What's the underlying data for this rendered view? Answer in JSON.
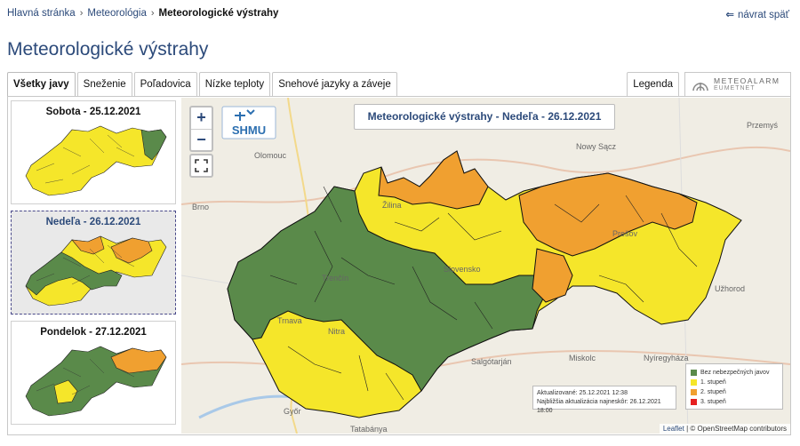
{
  "breadcrumb": {
    "home": "Hlavná stránka",
    "section": "Meteorológia",
    "current": "Meteorologické výstrahy"
  },
  "back_link": "návrat späť",
  "page_title": "Meteorologické výstrahy",
  "tabs": [
    "Všetky javy",
    "Sneženie",
    "Poľadovica",
    "Nízke teploty",
    "Snehové jazyky a záveje"
  ],
  "active_tab": "Všetky javy",
  "legend_tab": "Legenda",
  "meteoalarm": {
    "line1": "METEOALARM",
    "line2": "EUMETNET"
  },
  "days": [
    {
      "label": "Sobota - 25.12.2021",
      "selected": false
    },
    {
      "label": "Nedeľa - 26.12.2021",
      "selected": true
    },
    {
      "label": "Pondelok - 27.12.2021",
      "selected": false
    }
  ],
  "map": {
    "title": "Meteorologické výstrahy - Nedeľa - 26.12.2021",
    "zoom_in": "+",
    "zoom_out": "−",
    "logo_text": "SHMU",
    "cities": [
      "Olomouc",
      "Nowy Sącz",
      "Przemyś",
      "Brno",
      "Žilina",
      "Trenčín",
      "Prešov",
      "Slovensko",
      "Trnava",
      "Nitra",
      "Miskolc",
      "Salgótarján",
      "Nyíregyháza",
      "Győr",
      "Tatabánya",
      "Užhorod"
    ],
    "info": {
      "updated": "Aktualizované: 25.12.2021 12:38",
      "next": "Najbližšia aktualizácia najneskôr: 26.12.2021 18:00"
    },
    "legend": [
      {
        "label": "Bez nebezpečných javov",
        "color": "#5a8a4a"
      },
      {
        "label": "1. stupeň",
        "color": "#f5e62a"
      },
      {
        "label": "2. stupeň",
        "color": "#f0a030"
      },
      {
        "label": "3. stupeň",
        "color": "#e62020"
      }
    ],
    "attribution": {
      "leaflet": "Leaflet",
      "text": "| © OpenStreetMap contributors"
    }
  },
  "colors": {
    "green": "#5a8a4a",
    "yellow": "#f5e62a",
    "orange": "#f0a030",
    "red": "#e62020",
    "link": "#2c4a7a"
  }
}
